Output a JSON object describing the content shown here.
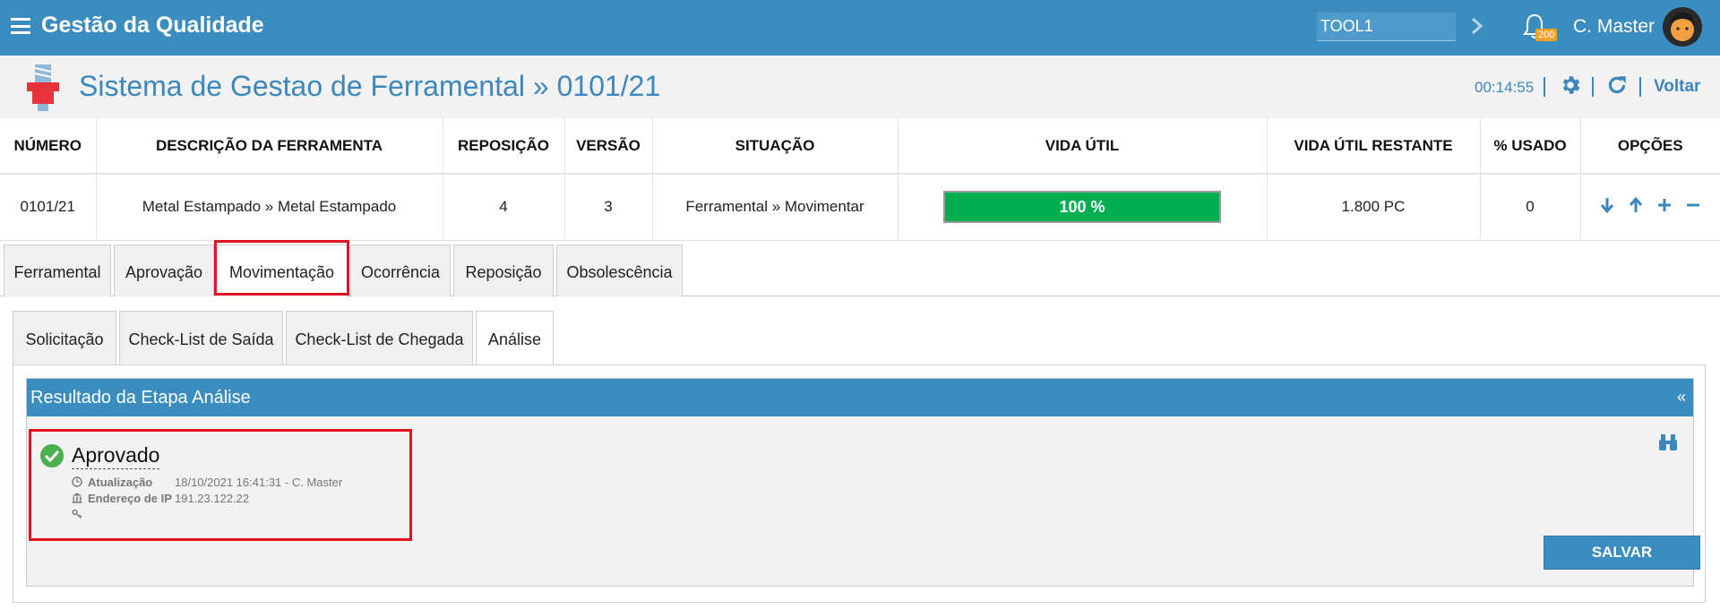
{
  "app": {
    "title": "Gestão da Qualidade"
  },
  "topbar": {
    "search_value": "TOOL1",
    "notifications_count": "200",
    "user_name": "C. Master"
  },
  "header": {
    "title": "Sistema de Gestao de Ferramental » 0101/21",
    "timer": "00:14:55",
    "back_label": "Voltar"
  },
  "table": {
    "columns": [
      "NÚMERO",
      "DESCRIÇÃO DA FERRAMENTA",
      "REPOSIÇÃO",
      "VERSÃO",
      "SITUAÇÃO",
      "VIDA ÚTIL",
      "VIDA ÚTIL RESTANTE",
      "% USADO",
      "OPÇÕES"
    ],
    "row": {
      "numero": "0101/21",
      "descricao": "Metal Estampado » Metal Estampado",
      "reposicao": "4",
      "versao": "3",
      "situacao": "Ferramental » Movimentar",
      "vida_util": "100 %",
      "vida_util_fraction": 1.0,
      "vida_util_restante": "1.800 PC",
      "pct_usado": "0"
    },
    "options_icons": [
      "arrow-down-icon",
      "arrow-up-icon",
      "plus-icon",
      "minus-icon"
    ]
  },
  "main_tabs": [
    {
      "label": "Ferramental"
    },
    {
      "label": "Aprovação"
    },
    {
      "label": "Movimentação",
      "active": true
    },
    {
      "label": "Ocorrência"
    },
    {
      "label": "Reposição"
    },
    {
      "label": "Obsolescência"
    }
  ],
  "sub_tabs": [
    {
      "label": "Solicitação"
    },
    {
      "label": "Check-List de Saída"
    },
    {
      "label": "Check-List de Chegada"
    },
    {
      "label": "Análise",
      "active": true
    }
  ],
  "result": {
    "title": "Resultado da Etapa Análise",
    "collapse_symbol": "«",
    "status": "Aprovado",
    "update_label": "Atualização",
    "update_value": "18/10/2021 16:41:31 - C. Master",
    "ip_label": "Endereço de IP",
    "ip_value": "191.23.122.22",
    "save_label": "SALVAR"
  },
  "colors": {
    "primary": "#3b8dc0",
    "success": "#00b050",
    "highlight": "#e0141e",
    "badge": "#f2a12a"
  }
}
